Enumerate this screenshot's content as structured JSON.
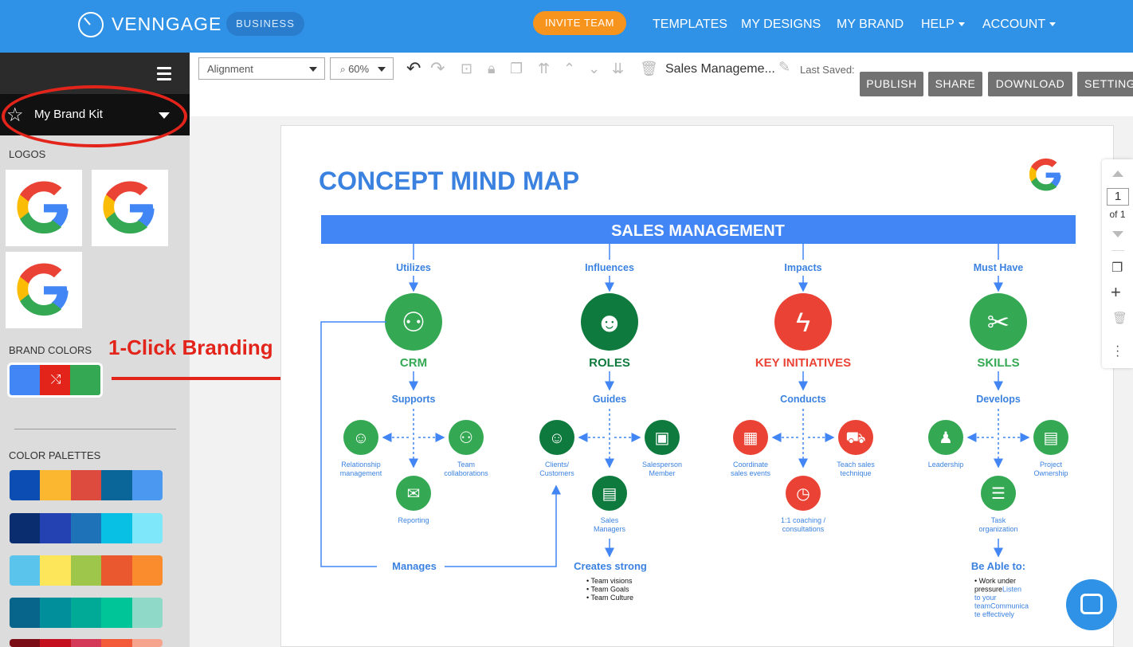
{
  "header": {
    "brand": "VENNGAGE",
    "plan_badge": "BUSINESS",
    "invite_label": "INVITE TEAM",
    "nav": [
      "TEMPLATES",
      "MY DESIGNS",
      "MY BRAND",
      "HELP",
      "ACCOUNT"
    ]
  },
  "sidebar": {
    "brand_kit_label": "My Brand Kit",
    "logos_title": "LOGOS",
    "brand_colors_title": "BRAND COLORS",
    "brand_colors": [
      "#4285f4",
      "#e3241b",
      "#34a853"
    ],
    "palettes_title": "COLOR PALETTES",
    "palettes": [
      [
        "#0b4db3",
        "#fbb72f",
        "#dd4b3e",
        "#0a6699",
        "#4a98ef"
      ],
      [
        "#0a2d6f",
        "#2442b1",
        "#1d72b8",
        "#07c0e4",
        "#7ee8fa"
      ],
      [
        "#5bc4ec",
        "#fde65a",
        "#9ec64b",
        "#e9582f",
        "#fb8c2d"
      ],
      [
        "#07648b",
        "#008f9b",
        "#00aa96",
        "#00c598",
        "#8ed9c7"
      ]
    ]
  },
  "annotation": {
    "text": "1-Click Branding"
  },
  "toolbar": {
    "alignment": "Alignment",
    "zoom": "60%",
    "doc_title": "Sales Manageme...",
    "last_saved": "Last Saved:",
    "buttons": [
      "PUBLISH",
      "SHARE",
      "DOWNLOAD",
      "SETTINGS"
    ]
  },
  "pager": {
    "current": "1",
    "total": "of 1"
  },
  "infographic": {
    "title": "CONCEPT MIND MAP",
    "banner": "SALES MANAGEMENT",
    "colors": {
      "blue": "#4285f4",
      "green": "#34a853",
      "dark_green": "#0f7a3e",
      "red": "#ea4335",
      "title_blue": "#3b82e0"
    },
    "columns": [
      {
        "relation": "Utilizes",
        "name": "CRM",
        "color": "green",
        "icon": "people-handshake-icon",
        "sub_relation": "Supports",
        "items": [
          {
            "label": [
              "Relationship",
              "management"
            ],
            "icon": "person-icon"
          },
          {
            "label": [
              "Team",
              "collaborations"
            ],
            "icon": "team-icon"
          },
          {
            "label": [
              "Reporting"
            ],
            "icon": "mail-alert-icon"
          }
        ]
      },
      {
        "relation": "Influences",
        "name": "ROLES",
        "color": "dark_green",
        "icon": "group-icon",
        "sub_relation": "Guides",
        "items": [
          {
            "label": [
              "Clients/",
              "Customers"
            ],
            "icon": "presenter-icon"
          },
          {
            "label": [
              "Salesperson",
              "Member"
            ],
            "icon": "briefcase-icon"
          },
          {
            "label": [
              "Sales",
              "Managers"
            ],
            "icon": "clipboard-icon"
          }
        ]
      },
      {
        "relation": "Impacts",
        "name": "KEY INITIATIVES",
        "color": "red",
        "icon": "lightning-icon",
        "sub_relation": "Conducts",
        "items": [
          {
            "label": [
              "Coordinate",
              "sales events"
            ],
            "icon": "calendar-icon"
          },
          {
            "label": [
              "Teach sales",
              "technique"
            ],
            "icon": "cart-icon"
          },
          {
            "label": [
              "1:1 coaching /",
              "consultations"
            ],
            "icon": "clock-icon"
          }
        ]
      },
      {
        "relation": "Must Have",
        "name": "SKILLS",
        "color": "green",
        "icon": "tools-icon",
        "sub_relation": "Develops",
        "items": [
          {
            "label": [
              "Leadership"
            ],
            "icon": "leader-icon"
          },
          {
            "label": [
              "Project",
              "Ownership"
            ],
            "icon": "document-icon"
          },
          {
            "label": [
              "Task",
              "organization"
            ],
            "icon": "checklist-icon"
          }
        ]
      }
    ],
    "manages_label": "Manages",
    "creates_label": "Creates strong",
    "creates_items": [
      "Team visions",
      "Team Goals",
      "Team Culture"
    ],
    "able_label": "Be Able to:",
    "able_items": [
      {
        "black": "Work under",
        "rest": ""
      },
      {
        "black": "pressure",
        "rest": "Listen"
      },
      {
        "black": "",
        "rest": "to your"
      },
      {
        "black": "",
        "rest": "teamCommunica"
      },
      {
        "black": "",
        "rest": "te effectively"
      }
    ]
  }
}
